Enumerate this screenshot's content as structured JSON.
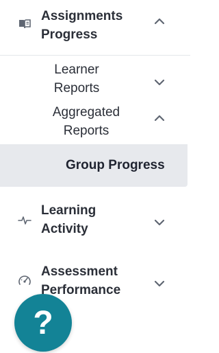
{
  "nav": {
    "assignments_progress": {
      "label_line1": "Assignments",
      "label_line2": "Progress",
      "icon": "book-icon",
      "expanded": true
    },
    "learner_reports": {
      "label_line1": "Learner",
      "label_line2": "Reports",
      "expanded": false
    },
    "aggregated_reports": {
      "label_line1": "Aggregated",
      "label_line2": "Reports",
      "expanded": true
    },
    "group_progress": {
      "label": "Group Progress",
      "active": true
    },
    "learning_activity": {
      "label_line1": "Learning",
      "label_line2": "Activity",
      "icon": "activity-pulse-icon",
      "expanded": false
    },
    "assessment_performance": {
      "label_line1": "Assessment",
      "label_line2": "Performance",
      "icon": "gauge-icon",
      "expanded": false
    }
  },
  "help": {
    "label": "?"
  },
  "colors": {
    "text": "#2b2f38",
    "active_bg": "#e7e9ed",
    "help_bg": "#138396",
    "chevron": "#5f6672"
  }
}
